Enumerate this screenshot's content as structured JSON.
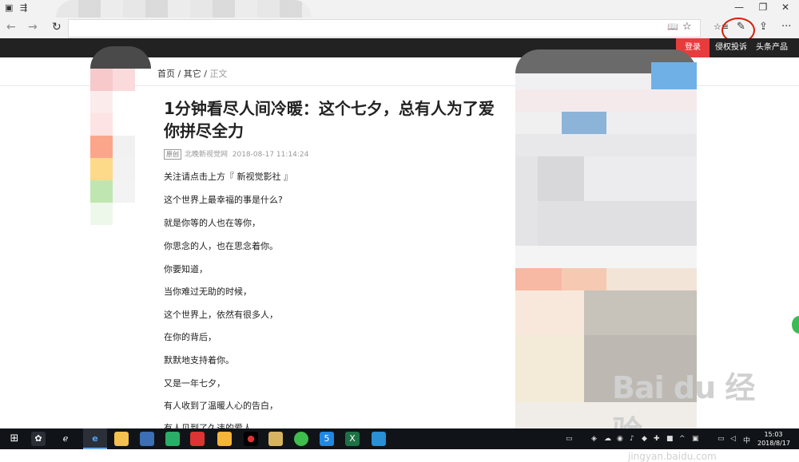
{
  "browser": {
    "icons": {
      "tabs": "tab-manager-icon",
      "back": "back-arrow-icon",
      "forward": "forward-arrow-icon",
      "refresh": "refresh-icon",
      "favorite": "star-icon",
      "hub": "hub-icon",
      "notes": "pen-icon",
      "share": "share-icon",
      "more": "ellipsis-icon"
    },
    "glyphs": {
      "tabs": "▣",
      "tab_preview": "⇶",
      "back": "←",
      "forward": "→",
      "refresh": "↻",
      "reading": "📖",
      "favorite": "☆",
      "hub": "☆≡",
      "notes": "✎",
      "share": "⇪",
      "more": "···",
      "minimize": "—",
      "maximize": "❐",
      "close": "✕"
    },
    "annotation_color": "#d81e06"
  },
  "site": {
    "nav": {
      "login": "登录",
      "report": "侵权投诉",
      "products": "头条产品"
    },
    "breadcrumb": {
      "home": "首页",
      "sep1": "/",
      "category": "其它",
      "sep2": "/",
      "current": "正文"
    },
    "article": {
      "title": "1分钟看尽人间冷暖：这个七夕，总有人为了爱你拼尽全力",
      "badge": "原创",
      "source": "北晚新视觉网",
      "datetime": "2018-08-17 11:14:24",
      "paragraphs": [
        "关注请点击上方『 新视觉影社 』",
        "这个世界上最幸福的事是什么?",
        "就是你等的人也在等你，",
        "你思念的人，也在思念着你。",
        "你要知道，",
        "当你难过无助的时候，",
        "这个世界上，依然有很多人，",
        "在你的背后，",
        "默默地支持着你。",
        "又是一年七夕，",
        "有人收到了温暖人心的告白，",
        "有人见到了久违的爱人，"
      ]
    }
  },
  "watermark": {
    "brand": "Bai du 经验",
    "url": "jingyan.baidu.com"
  },
  "taskbar": {
    "start_icon": "windows-start-icon",
    "time": "15:03",
    "date": "2018/8/17"
  }
}
